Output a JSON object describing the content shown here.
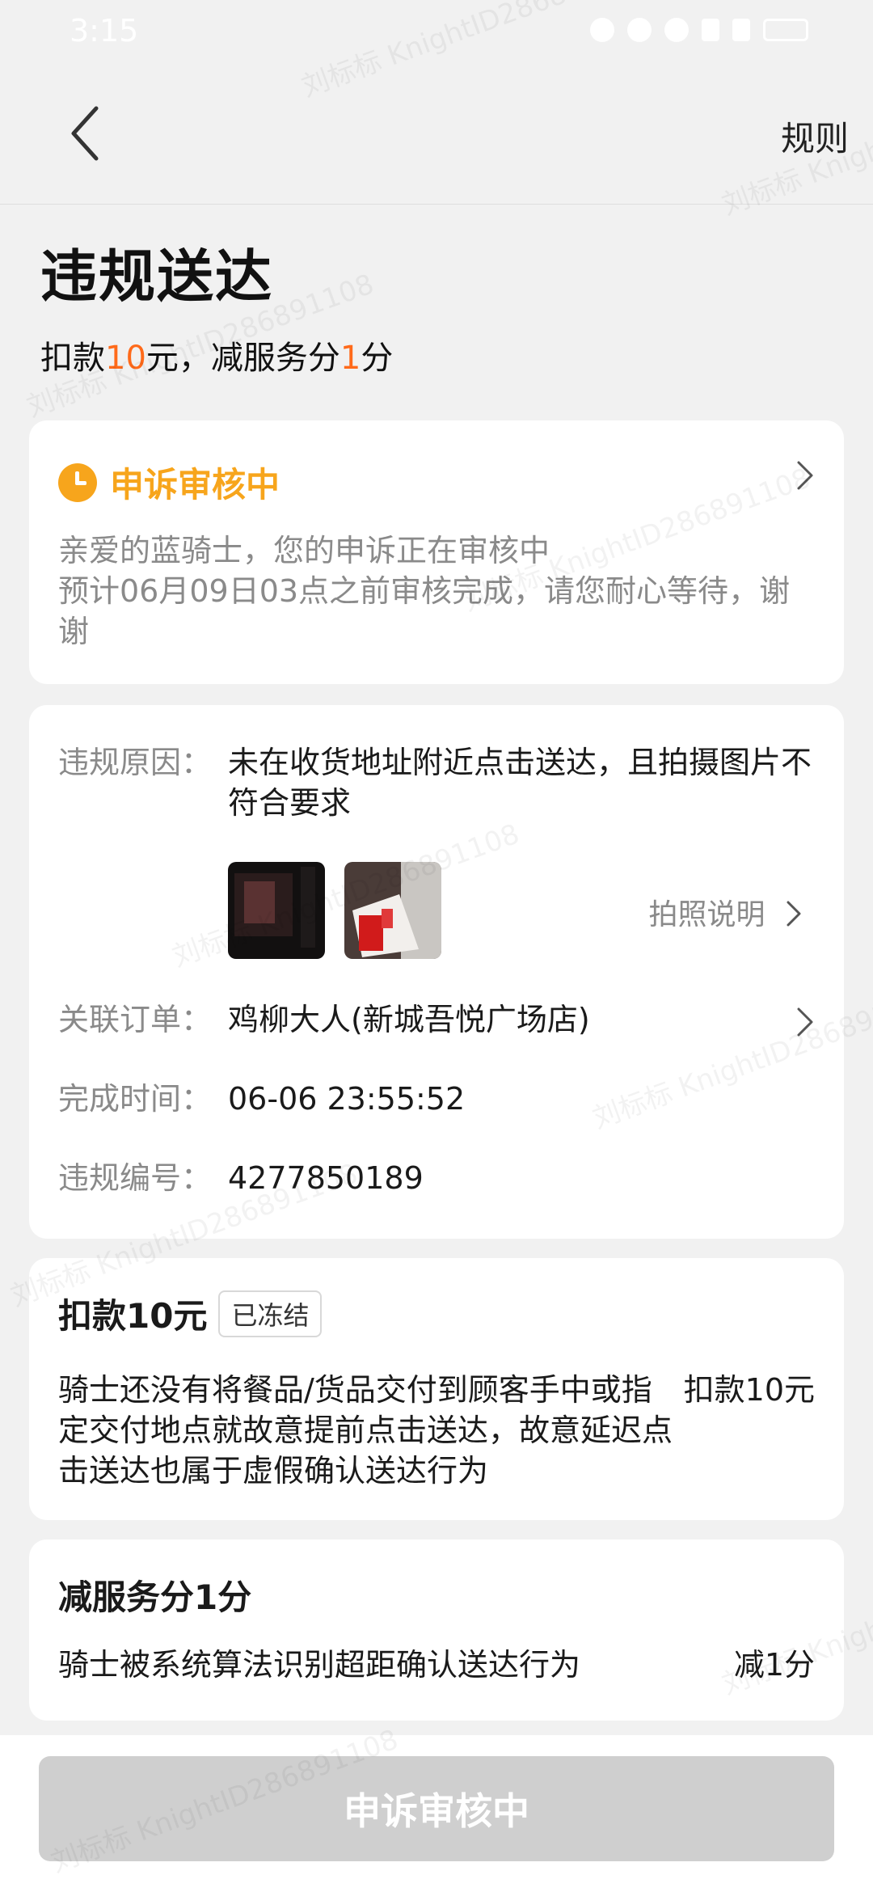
{
  "status_bar": {
    "time": "3:15"
  },
  "header": {
    "rules_label": "规则"
  },
  "page": {
    "title": "违规送达",
    "subtitle": {
      "prefix": "扣款",
      "amount": "10",
      "mid": "元，减服务分",
      "score": "1",
      "suffix": "分"
    }
  },
  "appeal_status": {
    "title": "申诉审核中",
    "line1": "亲爱的蓝骑士，您的申诉正在审核中",
    "line2": "预计06月09日03点之前审核完成，请您耐心等待，谢谢"
  },
  "violation": {
    "reason_label": "违规原因：",
    "reason_value": "未在收货地址附近点击送达，且拍摄图片不符合要求",
    "photo_note": "拍照说明",
    "order_label": "关联订单：",
    "order_value": "鸡柳大人(新城吾悦广场店)",
    "time_label": "完成时间：",
    "time_value": "06-06 23:55:52",
    "id_label": "违规编号：",
    "id_value": "4277850189"
  },
  "deduction": {
    "title": "扣款10元",
    "badge": "已冻结",
    "description": "骑士还没有将餐品/货品交付到顾客手中或指定交付地点就故意提前点击送达，故意延迟点击送达也属于虚假确认送达行为",
    "amount": "扣款10元"
  },
  "score": {
    "title": "减服务分1分",
    "description": "骑士被系统算法识别超距确认送达行为",
    "amount": "减1分"
  },
  "bottom_button": {
    "label": "申诉审核中"
  },
  "watermark": {
    "text": "刘标标 KnightID286891108"
  },
  "colors": {
    "accent_orange": "#ff6a1a",
    "status_yellow": "#f7a51c",
    "disabled_button": "#cfcfcf"
  }
}
